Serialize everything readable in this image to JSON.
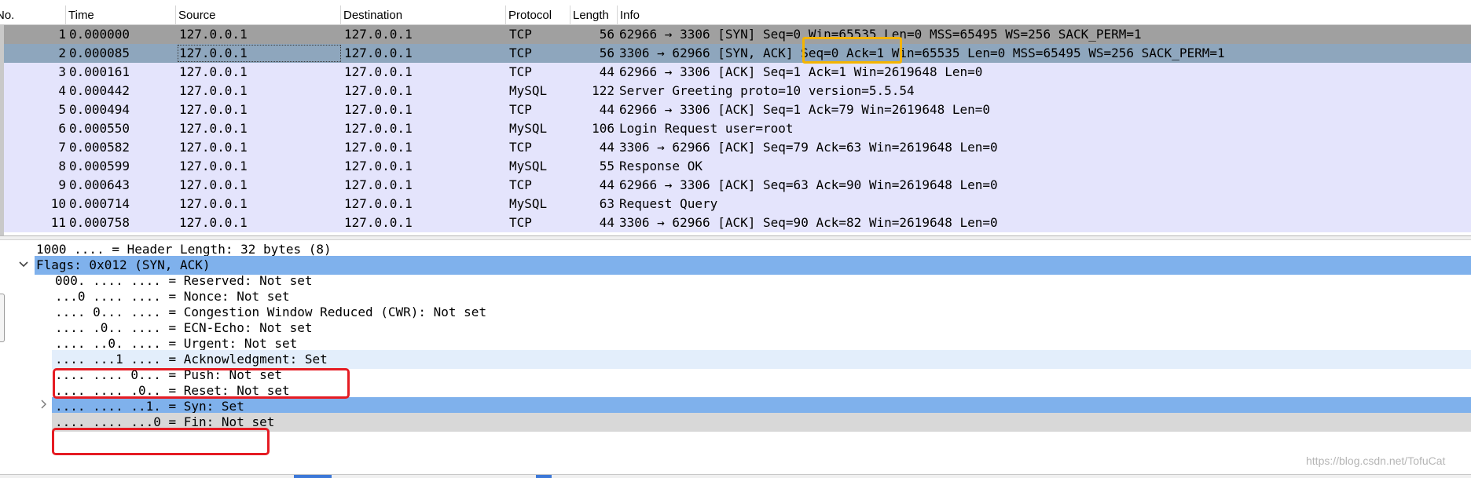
{
  "packet_list": {
    "columns": [
      "No.",
      "Time",
      "Source",
      "Destination",
      "Protocol",
      "Length",
      "Info"
    ],
    "rows": [
      {
        "no": "1",
        "time": "0.000000",
        "source": "127.0.0.1",
        "destination": "127.0.0.1",
        "protocol": "TCP",
        "length": "56",
        "info": "62966 → 3306 [SYN] Seq=0 Win=65535 Len=0 MSS=65495 WS=256 SACK_PERM=1"
      },
      {
        "no": "2",
        "time": "0.000085",
        "source": "127.0.0.1",
        "destination": "127.0.0.1",
        "protocol": "TCP",
        "length": "56",
        "info": "3306 → 62966 [SYN, ACK] Seq=0 Ack=1 Win=65535 Len=0 MSS=65495 WS=256 SACK_PERM=1"
      },
      {
        "no": "3",
        "time": "0.000161",
        "source": "127.0.0.1",
        "destination": "127.0.0.1",
        "protocol": "TCP",
        "length": "44",
        "info": "62966 → 3306 [ACK] Seq=1 Ack=1 Win=2619648 Len=0"
      },
      {
        "no": "4",
        "time": "0.000442",
        "source": "127.0.0.1",
        "destination": "127.0.0.1",
        "protocol": "MySQL",
        "length": "122",
        "info": "Server Greeting proto=10 version=5.5.54"
      },
      {
        "no": "5",
        "time": "0.000494",
        "source": "127.0.0.1",
        "destination": "127.0.0.1",
        "protocol": "TCP",
        "length": "44",
        "info": "62966 → 3306 [ACK] Seq=1 Ack=79 Win=2619648 Len=0"
      },
      {
        "no": "6",
        "time": "0.000550",
        "source": "127.0.0.1",
        "destination": "127.0.0.1",
        "protocol": "MySQL",
        "length": "106",
        "info": "Login Request user=root"
      },
      {
        "no": "7",
        "time": "0.000582",
        "source": "127.0.0.1",
        "destination": "127.0.0.1",
        "protocol": "TCP",
        "length": "44",
        "info": "3306 → 62966 [ACK] Seq=79 Ack=63 Win=2619648 Len=0"
      },
      {
        "no": "8",
        "time": "0.000599",
        "source": "127.0.0.1",
        "destination": "127.0.0.1",
        "protocol": "MySQL",
        "length": "55",
        "info": "Response OK"
      },
      {
        "no": "9",
        "time": "0.000643",
        "source": "127.0.0.1",
        "destination": "127.0.0.1",
        "protocol": "TCP",
        "length": "44",
        "info": "62966 → 3306 [ACK] Seq=63 Ack=90 Win=2619648 Len=0"
      },
      {
        "no": "10",
        "time": "0.000714",
        "source": "127.0.0.1",
        "destination": "127.0.0.1",
        "protocol": "MySQL",
        "length": "63",
        "info": "Request Query"
      },
      {
        "no": "11",
        "time": "0.000758",
        "source": "127.0.0.1",
        "destination": "127.0.0.1",
        "protocol": "TCP",
        "length": "44",
        "info": "3306 → 62966 [ACK] Seq=90 Ack=82 Win=2619648 Len=0"
      }
    ],
    "selected_row": "2"
  },
  "details": {
    "header_length": "1000 .... = Header Length: 32 bytes (8)",
    "flags": "Flags: 0x012 (SYN, ACK)",
    "flag_lines": [
      "000. .... .... = Reserved: Not set",
      "...0 .... .... = Nonce: Not set",
      ".... 0... .... = Congestion Window Reduced (CWR): Not set",
      ".... .0.. .... = ECN-Echo: Not set",
      ".... ..0. .... = Urgent: Not set",
      ".... ...1 .... = Acknowledgment: Set",
      ".... .... 0... = Push: Not set",
      ".... .... .0.. = Reset: Not set",
      ".... .... ..1. = Syn: Set",
      ".... .... ...0 = Fin: Not set"
    ]
  },
  "watermark": "https://blog.csdn.net/TofuCat",
  "colors": {
    "row_bg": "#e4e4fc",
    "row_selected": "#8ea6bd",
    "row_first": "#a0a0a0",
    "highlight_blue": "#7fb1ec",
    "annotation_orange": "#f4b400",
    "annotation_red": "#e51c23"
  },
  "icons": {
    "flags_expander": "chevron-down-icon",
    "syn_expander": "chevron-right-icon"
  }
}
